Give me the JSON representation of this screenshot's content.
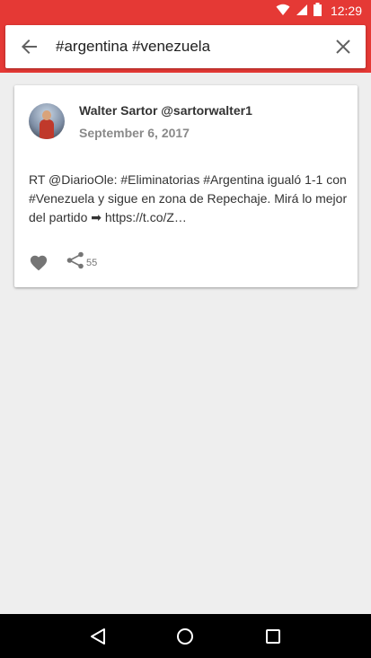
{
  "status_bar": {
    "time": "12:29",
    "icons": [
      "wifi-icon",
      "signal-icon",
      "battery-icon"
    ]
  },
  "search": {
    "query": "#argentina #venezuela",
    "back_icon": "arrow-back-icon",
    "clear_icon": "close-icon"
  },
  "tweet": {
    "author": "Walter Sartor @sartorwalter1",
    "date": "September 6, 2017",
    "text": "RT @DiarioOle: #Eliminatorias #Argentina igualó 1-1 con #Venezuela y sigue en zona de Repechaje. Mirá lo mejor del partido ➡ https://t.co/Z…",
    "share_count": "55",
    "like_icon": "heart-icon",
    "share_icon": "share-icon"
  },
  "nav": {
    "icons": [
      "nav-back-icon",
      "home-icon",
      "recents-icon"
    ]
  },
  "colors": {
    "accent": "#e53935",
    "background": "#eeeeee",
    "card": "#ffffff",
    "icon": "#757575"
  }
}
